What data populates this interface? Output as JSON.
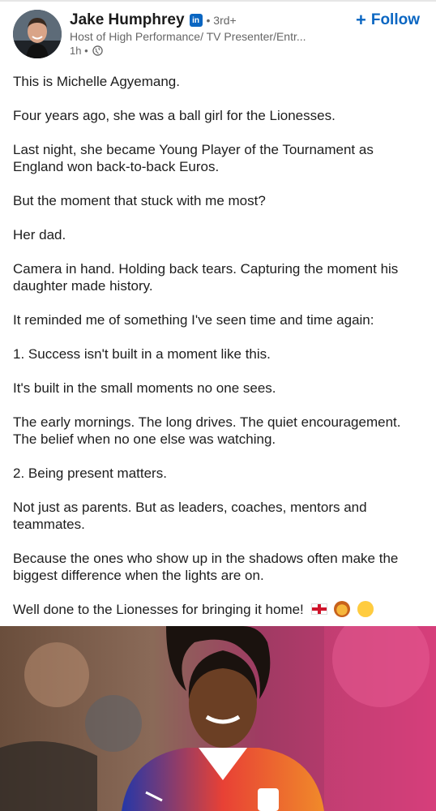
{
  "author": {
    "name": "Jake Humphrey",
    "badge": "in",
    "degree": "• 3rd+",
    "headline": "Host of High Performance/ TV Presenter/Entr...",
    "time": "1h •",
    "follow_label": "Follow"
  },
  "post": {
    "paragraphs": [
      "This is Michelle Agyemang.",
      "Four years ago, she was a ball girl for the Lionesses.",
      "Last night, she became Young Player of the Tournament as England won back-to-back Euros.",
      "But the moment that stuck with me most?",
      "Her dad.",
      "Camera in hand. Holding back tears. Capturing the moment his daughter made history.",
      "It reminded me of something I've seen time and time again:",
      "1. Success isn't built in a moment like this.",
      "It's built in the small moments no one sees.",
      "The early mornings. The long drives. The quiet encouragement. The belief when no one else was watching.",
      "2. Being present matters.",
      "Not just as parents. But as leaders, coaches, mentors and teammates.",
      "Because the ones who show up in the shadows often make the biggest difference when the lights are on."
    ],
    "last_line": "Well done to the Lionesses for bringing it home!",
    "emojis": [
      "england-flag",
      "lion-face",
      "partying-face"
    ]
  },
  "colors": {
    "accent": "#0a66c2",
    "text": "#1d1d1d",
    "muted": "#666666"
  }
}
